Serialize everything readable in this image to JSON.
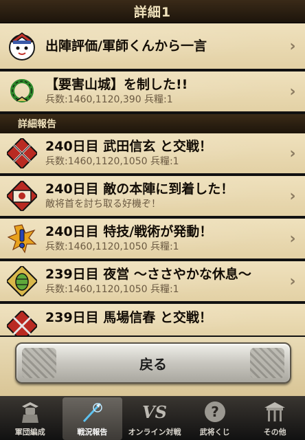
{
  "header": {
    "title": "詳細1"
  },
  "top_rows": [
    {
      "title": "出陣評価/軍師くんから一言",
      "subtitle": "",
      "icon": "gunshi-avatar-icon"
    },
    {
      "title": "【要害山城】を制した!!",
      "subtitle": "兵数:1460,1120,390 兵糧:1",
      "icon": "laurel-wreath-icon"
    }
  ],
  "section": {
    "label": "詳細報告"
  },
  "report_rows": [
    {
      "title": "240日目 武田信玄 と交戦！",
      "subtitle": "兵数:1460,1120,1050 兵糧:1",
      "icon": "crossed-swords-icon"
    },
    {
      "title": "240日目 敵の本陣に到着した！",
      "subtitle": "敵将首を討ち取る好機ぞ！",
      "icon": "enemy-camp-icon"
    },
    {
      "title": "240日目 特技/戦術が発動！",
      "subtitle": "兵数:1460,1120,1050 兵糧:1",
      "icon": "exclamation-icon"
    },
    {
      "title": "239日目 夜営 〜ささやかな休息〜",
      "subtitle": "兵数:1460,1120,1050 兵糧:1",
      "icon": "rice-bale-icon"
    },
    {
      "title": "239日目 馬場信春 と交戦！",
      "subtitle": "",
      "icon": "crossed-swords-icon"
    }
  ],
  "back_button": {
    "label": "戻る"
  },
  "tabbar": {
    "tabs": [
      {
        "label": "軍団編成",
        "icon": "samurai-armor-icon",
        "active": false
      },
      {
        "label": "戦況報告",
        "icon": "spear-icon",
        "active": true
      },
      {
        "label": "オンライン対戦",
        "icon": "vs-icon",
        "active": false
      },
      {
        "label": "武将くじ",
        "icon": "question-mark-icon",
        "active": false
      },
      {
        "label": "その他",
        "icon": "temple-gate-icon",
        "active": false
      }
    ]
  },
  "colors": {
    "paper": "#e8d7ad",
    "dark_bar": "#2a1e12",
    "title_text": "#120c05",
    "sub_text": "#6b5a42"
  }
}
